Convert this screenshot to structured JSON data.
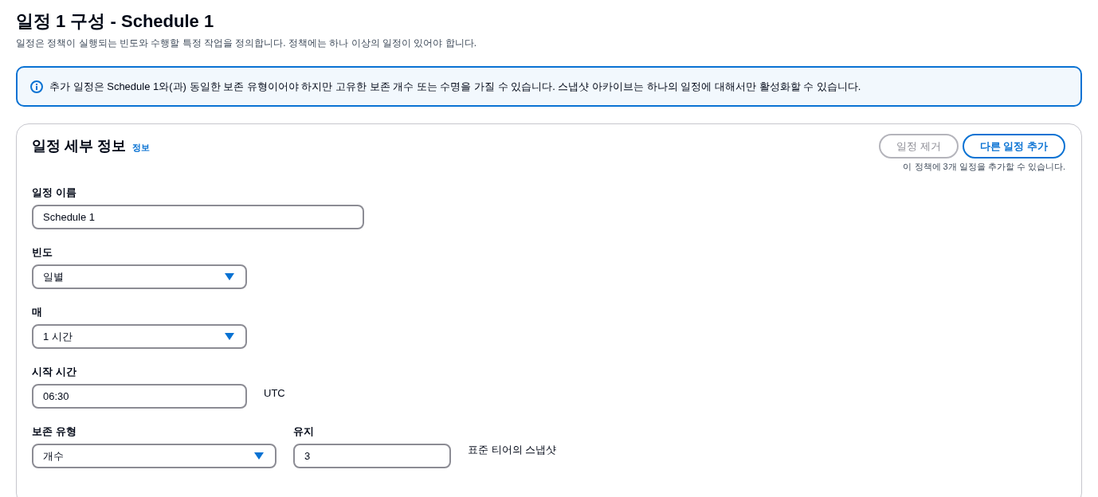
{
  "page": {
    "title": "일정 1 구성 - Schedule 1",
    "description": "일정은 정책이 실행되는 빈도와 수행할 특정 작업을 정의합니다. 정책에는 하나 이상의 일정이 있어야 합니다."
  },
  "alert": {
    "text": "추가 일정은 Schedule 1와(과) 동일한 보존 유형이어야 하지만 고유한 보존 개수 또는 수명을 가질 수 있습니다. 스냅샷 아카이브는 하나의 일정에 대해서만 활성화할 수 있습니다."
  },
  "card": {
    "title": "일정 세부 정보",
    "info_link": "정보",
    "buttons": [
      {
        "label": "일정 제거",
        "disabled": true
      },
      {
        "label": "다른 일정 추가",
        "disabled": false
      }
    ],
    "caption": "이 정책에 3개 일정을 추가할 수 있습니다.",
    "rows": [
      {
        "fields": [
          {
            "kind": "text",
            "label": "일정 이름",
            "value": "Schedule 1"
          }
        ]
      },
      {
        "fields": [
          {
            "kind": "select",
            "label": "빈도",
            "value": "일별"
          }
        ]
      },
      {
        "fields": [
          {
            "kind": "select",
            "label": "매",
            "value": "1 시간"
          }
        ]
      },
      {
        "fields": [
          {
            "kind": "text",
            "label": "시작 시간",
            "value": "06:30"
          }
        ],
        "note": "UTC"
      },
      {
        "fields": [
          {
            "kind": "select",
            "label": "보존 유형",
            "value": "개수"
          },
          {
            "kind": "text",
            "label": "유지",
            "value": "3"
          }
        ],
        "note": "표준 티어의 스냅샷"
      }
    ]
  }
}
